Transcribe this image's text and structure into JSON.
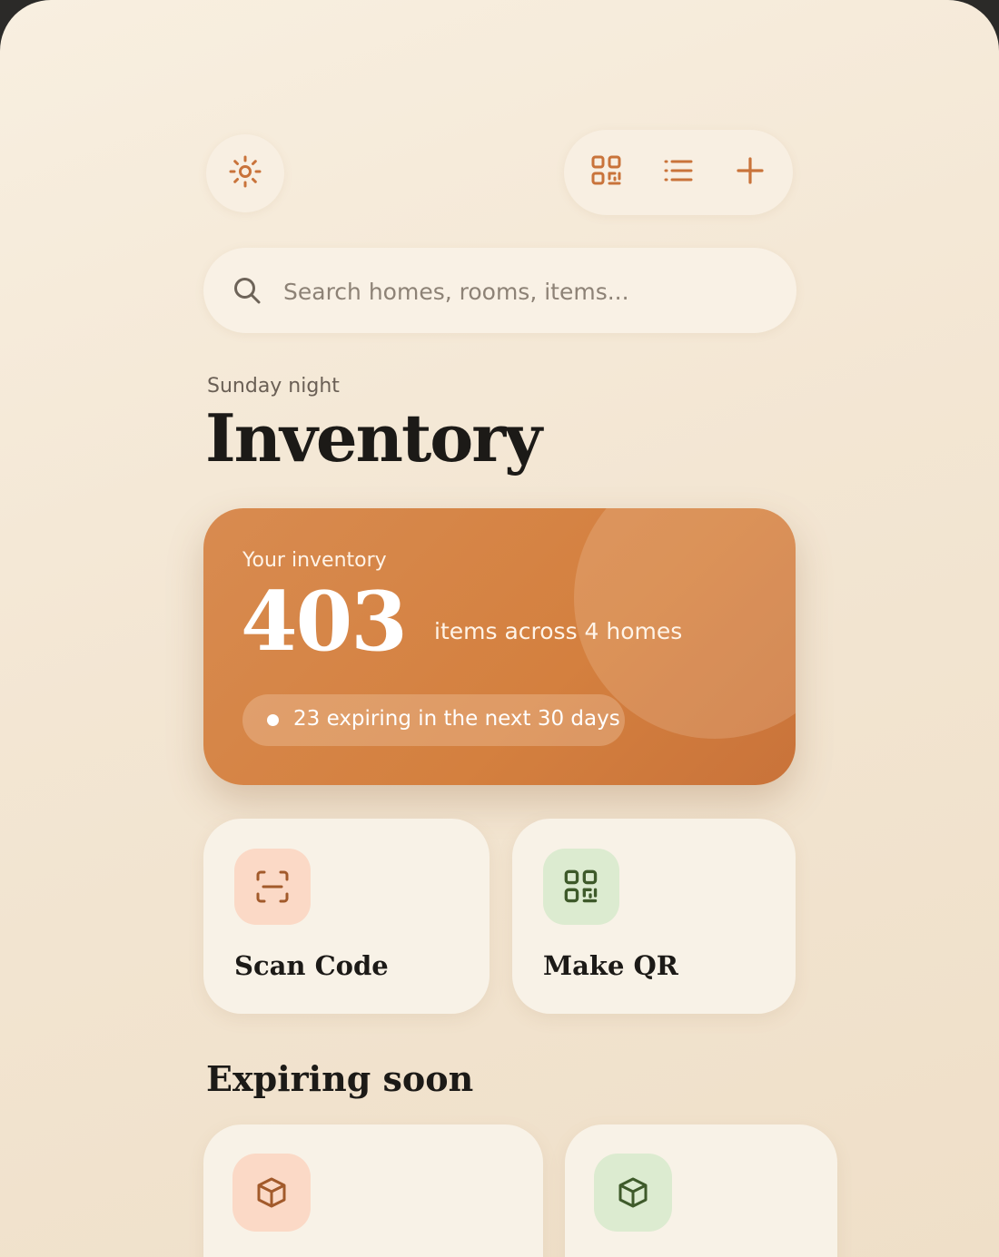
{
  "icons": {
    "theme": "sun-icon",
    "grid_view": "qr-grid-icon",
    "list_view": "list-icon",
    "add": "plus-icon",
    "search": "search-icon",
    "scan": "scan-icon",
    "qr": "qr-grid-icon",
    "item": "box-icon"
  },
  "colors": {
    "accent": "#c9733a",
    "hero_bg": "#d4803f",
    "scan_tile": "#fbd9c6",
    "qr_tile": "#dcebd0"
  },
  "search": {
    "placeholder": "Search homes, rooms, items..."
  },
  "header": {
    "subtitle": "Sunday night",
    "title": "Inventory"
  },
  "summary": {
    "label": "Your inventory",
    "count": "403",
    "description": "items across 4 homes",
    "expiring_note": "23 expiring in the next 30 days"
  },
  "actions": [
    {
      "label": "Scan Code",
      "icon": "scan-icon"
    },
    {
      "label": "Make QR",
      "icon": "qr-grid-icon"
    }
  ],
  "expiring": {
    "title": "Expiring soon",
    "cards": [
      {
        "icon": "box-icon"
      },
      {
        "icon": "box-icon"
      }
    ]
  }
}
